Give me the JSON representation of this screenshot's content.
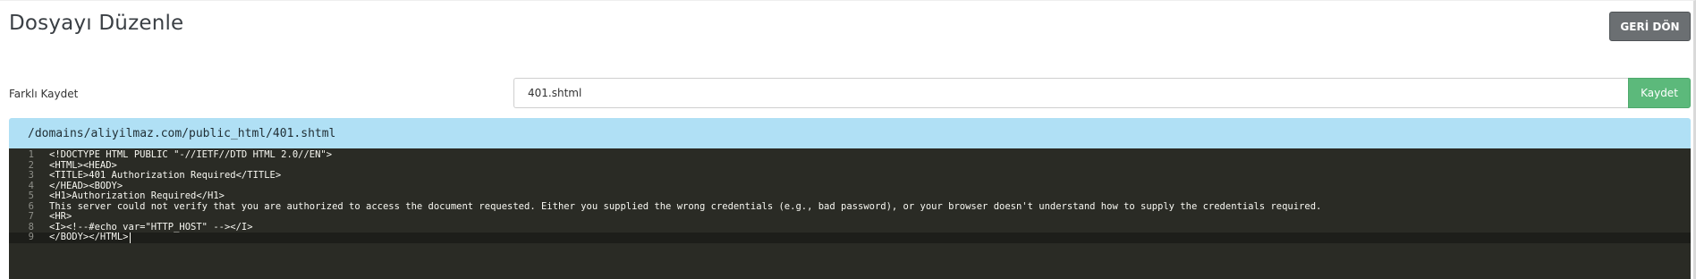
{
  "header": {
    "title": "Dosyayı Düzenle",
    "back_label": "GERİ DÖN"
  },
  "save_as": {
    "label": "Farklı Kaydet",
    "filename": "401.shtml",
    "save_label": "Kaydet"
  },
  "editor": {
    "path": "/domains/aliyilmaz.com/public_html/401.shtml",
    "lines": [
      {
        "number": "1",
        "text": "<!DOCTYPE HTML PUBLIC \"-//IETF//DTD HTML 2.0//EN\">"
      },
      {
        "number": "2",
        "text": "<HTML><HEAD>"
      },
      {
        "number": "3",
        "text": "<TITLE>401 Authorization Required</TITLE>"
      },
      {
        "number": "4",
        "text": "</HEAD><BODY>"
      },
      {
        "number": "5",
        "text": "<H1>Authorization Required</H1>"
      },
      {
        "number": "6",
        "text": "This server could not verify that you are authorized to access the document requested. Either you supplied the wrong credentials (e.g., bad password), or your browser doesn't understand how to supply the credentials required."
      },
      {
        "number": "7",
        "text": "<HR>"
      },
      {
        "number": "8",
        "text": "<I><!--#echo var=\"HTTP_HOST\" --></I>"
      },
      {
        "number": "9",
        "text": "</BODY></HTML>"
      }
    ],
    "active_line": 9
  }
}
